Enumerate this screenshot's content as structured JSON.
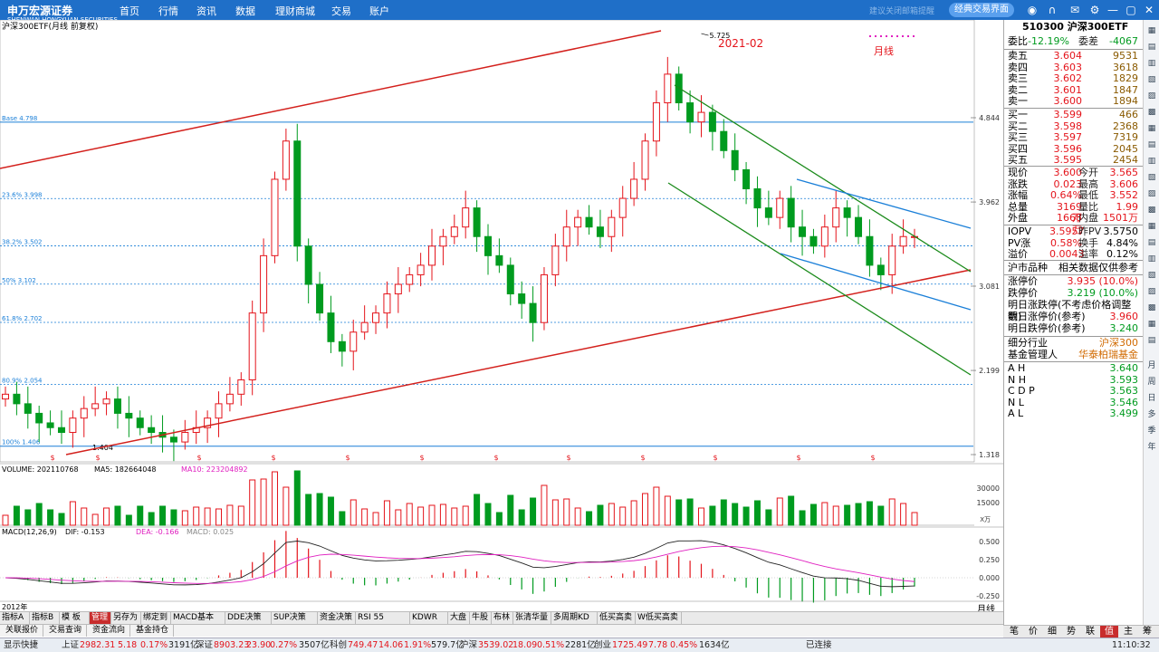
{
  "topbar": {
    "logo": "申万宏源证券",
    "logo_sub": "SHENWAN HONGYUAN SECURITIES",
    "nav": [
      "首页",
      "行情",
      "资讯",
      "数据",
      "理财商城",
      "交易",
      "账户"
    ],
    "classic_button": "经典交易界面",
    "faint_message": "建议关闭邮箱提醒"
  },
  "chart": {
    "title": "沪深300ETF(月线 前复权)",
    "annotation_year": "2021-02",
    "annotation_period": "月线",
    "high_label": "5.725",
    "low_label": "1.404",
    "fib_levels": [
      {
        "label": "Base 4.798",
        "value": 4.798
      },
      {
        "label": "23.6% 3.998",
        "value": 3.998
      },
      {
        "label": "38.2% 3.502",
        "value": 3.502
      },
      {
        "label": "50% 3.102",
        "value": 3.102
      },
      {
        "label": "61.8% 2.702",
        "value": 2.702
      },
      {
        "label": "80.9% 2.054",
        "value": 2.054
      },
      {
        "label": "100% 1.406",
        "value": 1.406
      }
    ],
    "right_axis": [
      "4.844",
      "3.962",
      "3.081",
      "2.199",
      "1.318"
    ],
    "volume_header": "VOLUME: 202110768",
    "volume_ma5": "MA5: 182664048",
    "volume_ma10": "MA10: 223204892",
    "volume_axis": [
      "30000",
      "15000"
    ],
    "volume_unit": "X万",
    "macd_header": "MACD(12,26,9)",
    "macd_dif": "DIF: -0.153",
    "macd_dea": "DEA: -0.166",
    "macd_val": "MACD: 0.025",
    "macd_axis": [
      "0.500",
      "0.250",
      "0.000",
      "-0.250"
    ],
    "start_year_label": "2012年",
    "period_label": "月线"
  },
  "chart_data": {
    "type": "candlestick",
    "title": "沪深300ETF(月线 前复权)",
    "approx_monthly_closes": [
      1.95,
      1.85,
      1.75,
      1.65,
      1.6,
      1.55,
      1.7,
      1.8,
      1.85,
      1.9,
      1.75,
      1.7,
      1.6,
      1.55,
      1.5,
      1.45,
      1.55,
      1.6,
      1.7,
      1.85,
      1.95,
      2.1,
      2.8,
      3.4,
      4.2,
      4.6,
      3.5,
      3.1,
      2.8,
      2.5,
      2.4,
      2.6,
      2.7,
      2.8,
      3.0,
      3.1,
      3.2,
      3.3,
      3.5,
      3.6,
      3.7,
      3.9,
      3.6,
      3.4,
      3.3,
      3.0,
      2.9,
      2.7,
      3.2,
      3.5,
      3.7,
      3.8,
      3.7,
      3.6,
      3.8,
      4.0,
      4.2,
      4.6,
      5.0,
      5.3,
      5.0,
      4.8,
      4.9,
      4.7,
      4.5,
      4.3,
      4.1,
      3.9,
      3.8,
      4.0,
      3.7,
      3.6,
      3.5,
      3.7,
      3.9,
      3.8,
      3.6,
      3.3,
      3.2,
      3.5,
      3.6,
      3.6
    ],
    "last_price": 3.6,
    "ylim": [
      1.318,
      5.8
    ],
    "grid": true
  },
  "quote": {
    "code_name": "510300 沪深300ETF",
    "weibi_label": "委比",
    "weibi": "-12.19%",
    "weicha_label": "委差",
    "weicha": "-4067",
    "asks": [
      {
        "label": "卖五",
        "price": "3.604",
        "vol": "9531"
      },
      {
        "label": "卖四",
        "price": "3.603",
        "vol": "3618"
      },
      {
        "label": "卖三",
        "price": "3.602",
        "vol": "1829"
      },
      {
        "label": "卖二",
        "price": "3.601",
        "vol": "1847"
      },
      {
        "label": "卖一",
        "price": "3.600",
        "vol": "1894"
      }
    ],
    "bids": [
      {
        "label": "买一",
        "price": "3.599",
        "vol": "466"
      },
      {
        "label": "买二",
        "price": "3.598",
        "vol": "2368"
      },
      {
        "label": "买三",
        "price": "3.597",
        "vol": "7319"
      },
      {
        "label": "买四",
        "price": "3.596",
        "vol": "2045"
      },
      {
        "label": "买五",
        "price": "3.595",
        "vol": "2454"
      }
    ],
    "stats": [
      {
        "l": "现价",
        "v": "3.600",
        "l2": "今开",
        "v2": "3.565"
      },
      {
        "l": "涨跌",
        "v": "0.023",
        "l2": "最高",
        "v2": "3.606"
      },
      {
        "l": "涨幅",
        "v": "0.64%",
        "l2": "最低",
        "v2": "3.552"
      },
      {
        "l": "总量",
        "v": "3169万",
        "l2": "量比",
        "v2": "1.99"
      },
      {
        "l": "外盘",
        "v": "1668万",
        "l2": "内盘",
        "v2": "1501万"
      }
    ],
    "iopv": [
      {
        "l": "IOPV",
        "v": "3.5957",
        "l2": "昨PV",
        "v2": "3.5750"
      },
      {
        "l": "PV涨",
        "v": "0.58%",
        "l2": "换手",
        "v2": "4.84%"
      },
      {
        "l": "溢价",
        "v": "0.0043",
        "l2": "溢率",
        "v2": "0.12%"
      }
    ],
    "category_label": "沪市品种",
    "category_note": "相关数据仅供参考",
    "limit_up_label": "涨停价",
    "limit_up": "3.935 (10.0%)",
    "limit_down_label": "跌停价",
    "limit_down": "3.219 (10.0%)",
    "tomorrow_note": "明日涨跌停(不考虑价格调整数)",
    "tomorrow_up_label": "明日涨停价(参考)",
    "tomorrow_up": "3.960",
    "tomorrow_down_label": "明日跌停价(参考)",
    "tomorrow_down": "3.240",
    "industry_label": "细分行业",
    "industry": "沪深300",
    "manager_label": "基金管理人",
    "manager": "华泰柏瑞基金",
    "related": [
      {
        "l": "A H",
        "v": "3.640"
      },
      {
        "l": "N H",
        "v": "3.593"
      },
      {
        "l": "C D P",
        "v": "3.563"
      },
      {
        "l": "N L",
        "v": "3.546"
      },
      {
        "l": "A L",
        "v": "3.499"
      }
    ]
  },
  "right_tools": [
    "月",
    "周",
    "日",
    "多",
    "季",
    "年"
  ],
  "bottom_tabs": [
    "指标A",
    "指标B",
    "模 板",
    "管理",
    "另存为",
    "绑定到",
    "MACD基本",
    "DDE决策",
    "SUP决策",
    "资金决策",
    "RSI 55",
    "KDWR",
    "大盘",
    "牛股",
    "布林",
    "张清华量",
    "多周期KD",
    "低买高卖",
    "W低买高卖"
  ],
  "bottom_tabs2": [
    "关联报价",
    "交易查询",
    "资金流向",
    "基金持仓"
  ],
  "side_tabs": [
    "笔",
    "价",
    "细",
    "势",
    "联",
    "值",
    "主",
    "筹"
  ],
  "status": {
    "show_quick": "显示快捷",
    "sh_label": "上证",
    "sh_val": "2982.31",
    "sh_chg": "5.18",
    "sh_pct": "0.17%",
    "sh_vol": "3191亿",
    "sz_label": "深证",
    "sz_val": "8903.23",
    "sz_chg": "23.90",
    "sz_pct": "0.27%",
    "sz_vol": "3507亿",
    "kc_label": "科创",
    "kc_val": "749.47",
    "kc_chg": "14.06",
    "kc_pct": "1.91%",
    "kc_vol": "579.7亿",
    "hs_label": "沪深",
    "hs_val": "3539.02",
    "hs_chg": "18.09",
    "hs_pct": "0.51%",
    "hs_vol": "2281亿",
    "cy_label": "创业",
    "cy_val": "1725.49",
    "cy_chg": "7.78",
    "cy_pct": "0.45%",
    "cy_vol": "1634亿",
    "connected": "已连接",
    "time": "11:10:32"
  }
}
